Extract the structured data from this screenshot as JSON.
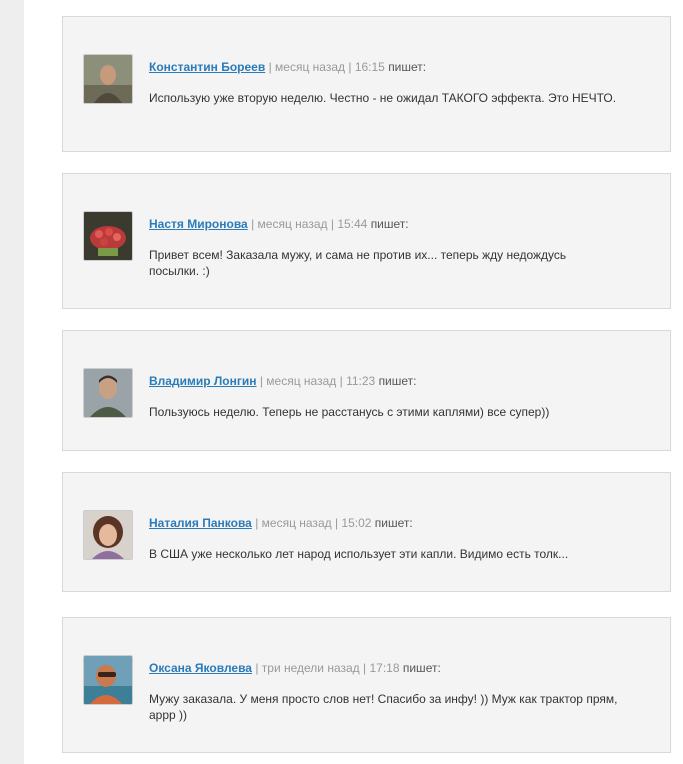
{
  "comments": [
    {
      "author": "Константин Бореев",
      "time_ago": "месяц назад",
      "time": "16:15",
      "writes": "пишет:",
      "text": "Использую уже вторую неделю. Честно - не ожидал ТАКОГО эффекта. Это НЕЧТО."
    },
    {
      "author": "Настя Миронова",
      "time_ago": "месяц назад",
      "time": "15:44",
      "writes": "пишет:",
      "text": "Привет всем! Заказала мужу, и сама не против их... теперь жду недождусь посылки. :)"
    },
    {
      "author": "Владимир Лонгин",
      "time_ago": "месяц назад",
      "time": "11:23",
      "writes": "пишет:",
      "text": "Пользуюсь неделю. Теперь не расстанусь с этими каплями) все супер))"
    },
    {
      "author": "Наталия Панкова",
      "time_ago": "месяц назад",
      "time": "15:02",
      "writes": "пишет:",
      "text": "В США уже несколько лет народ использует эти капли. Видимо есть толк..."
    },
    {
      "author": "Оксана Яковлева",
      "time_ago": "три недели назад",
      "time": "17:18",
      "writes": "пишет:",
      "text": "Мужу заказала. У меня просто слов нет! Спасибо за инфу! )) Муж как трактор прям, аррр ))"
    }
  ],
  "colors": {
    "author_link": "#2b7bb9",
    "meta": "#999999",
    "card_bg": "#f4f4f4",
    "card_border": "#d9d9d9"
  }
}
